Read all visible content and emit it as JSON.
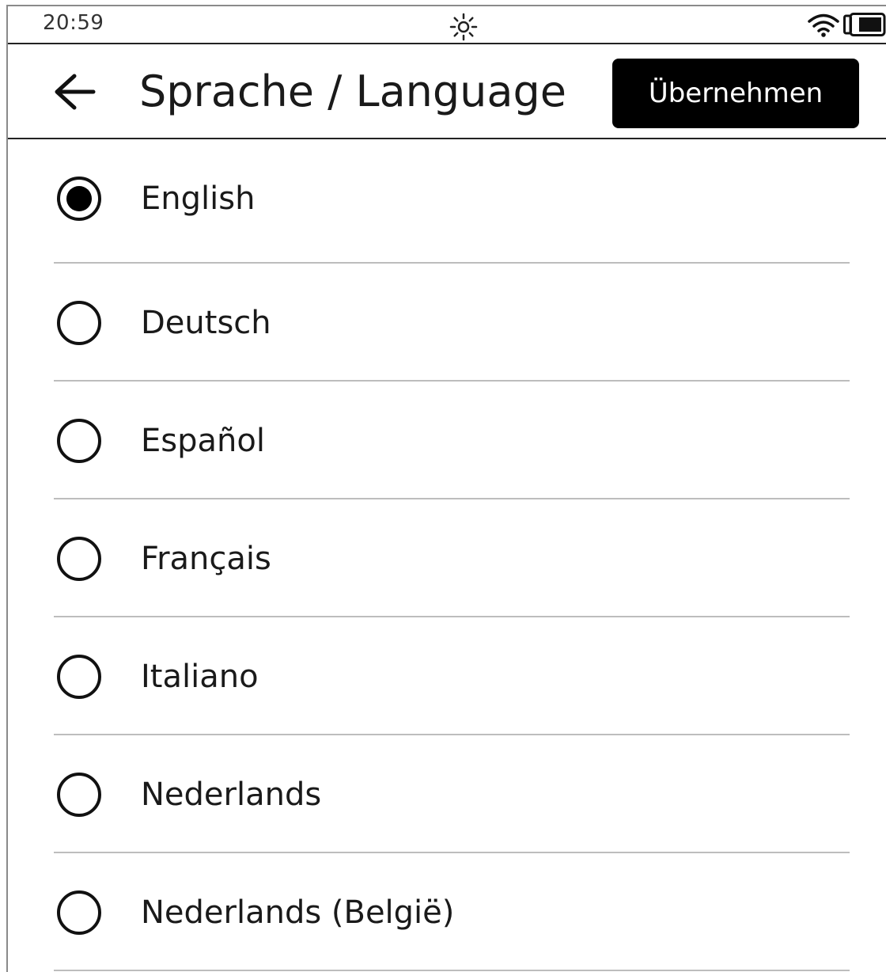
{
  "status_bar": {
    "time": "20:59",
    "icons": [
      "frontlight-icon",
      "wifi-icon",
      "battery-icon"
    ]
  },
  "header": {
    "back_icon": "arrow-left-icon",
    "title": "Sprache / Language",
    "apply_label": "Übernehmen"
  },
  "languages": {
    "selected": "English",
    "items": [
      {
        "label": "English",
        "checked": true
      },
      {
        "label": "Deutsch",
        "checked": false
      },
      {
        "label": "Español",
        "checked": false
      },
      {
        "label": "Français",
        "checked": false
      },
      {
        "label": "Italiano",
        "checked": false
      },
      {
        "label": "Nederlands",
        "checked": false
      },
      {
        "label": "Nederlands (België)",
        "checked": false
      }
    ]
  },
  "colors": {
    "background": "#ffffff",
    "foreground": "#111111",
    "button_bg": "#000000",
    "button_fg": "#ffffff",
    "divider": "#bdbdbd"
  }
}
